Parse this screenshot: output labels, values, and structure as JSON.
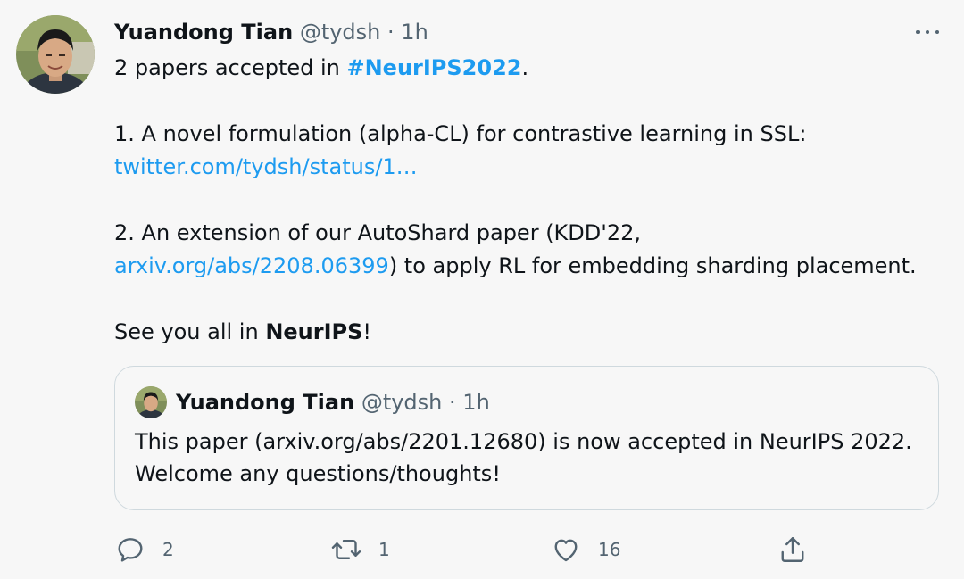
{
  "tweet": {
    "author_name": "Yuandong Tian",
    "handle": "@tydsh",
    "separator": "·",
    "time": "1h",
    "lines": {
      "l1_text": "2 papers accepted in ",
      "l1_hashtag": "#NeurIPS2022",
      "l1_end": ".",
      "l2_text": "1. A novel formulation (alpha-CL) for contrastive learning in SSL:",
      "l3_link": "twitter.com/tydsh/status/1…",
      "l4_text": "2. An extension of our AutoShard paper (KDD'22,",
      "l5_link": "arxiv.org/abs/2208.06399",
      "l5_text": ") to apply RL for embedding sharding placement.",
      "l6_text": "See you all in ",
      "l6_bold": "NeurIPS",
      "l6_end": "!"
    }
  },
  "quoted": {
    "author_name": "Yuandong Tian",
    "handle": "@tydsh",
    "separator": "·",
    "time": "1h",
    "text": "This paper (arxiv.org/abs/2201.12680) is now accepted in NeurIPS 2022. Welcome any questions/thoughts!"
  },
  "actions": {
    "reply_count": "2",
    "retweet_count": "1",
    "like_count": "16"
  },
  "icons": {
    "more": "more-horizontal-icon",
    "reply": "reply-icon",
    "retweet": "retweet-icon",
    "like": "heart-icon",
    "share": "share-icon"
  },
  "colors": {
    "background": "#f7f7f7",
    "text": "#0f1419",
    "muted": "#536471",
    "link": "#1d9bf0",
    "border": "#cfd9de"
  }
}
